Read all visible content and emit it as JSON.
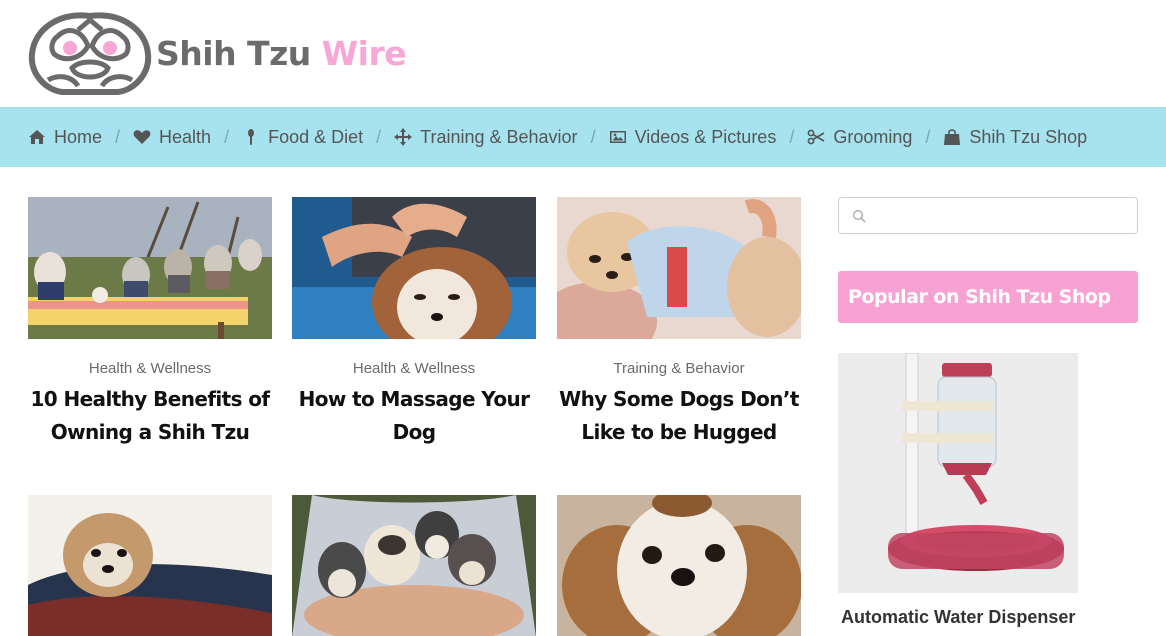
{
  "brand": {
    "name_part1": "Shih Tzu",
    "name_part2": "Wire"
  },
  "nav": [
    {
      "label": "Home",
      "icon": "home-icon"
    },
    {
      "label": "Health",
      "icon": "heart-icon"
    },
    {
      "label": "Food & Diet",
      "icon": "spoon-icon"
    },
    {
      "label": "Training & Behavior",
      "icon": "move-icon"
    },
    {
      "label": "Videos & Pictures",
      "icon": "picture-icon"
    },
    {
      "label": "Grooming",
      "icon": "scissors-icon"
    },
    {
      "label": "Shih Tzu Shop",
      "icon": "shopping-bag-icon"
    }
  ],
  "posts": [
    {
      "category": "Health & Wellness",
      "title": "10 Healthy Benefits of Owning a Shih Tzu"
    },
    {
      "category": "Health & Wellness",
      "title": "How to Massage Your Dog"
    },
    {
      "category": "Training & Behavior",
      "title": "Why Some Dogs Don’t Like to be Hugged"
    },
    {
      "category": "",
      "title": ""
    },
    {
      "category": "",
      "title": ""
    },
    {
      "category": "",
      "title": ""
    }
  ],
  "sidebar": {
    "search_placeholder": "",
    "promo_heading": "Popular on Shih Tzu Shop",
    "product_name": "Automatic Water Dispenser"
  },
  "colors": {
    "nav_bg": "#a6e3ee",
    "brand_pink": "#f7a6d6",
    "promo_pink": "#f8a2d4",
    "logo_gray": "#6b6b6b"
  }
}
